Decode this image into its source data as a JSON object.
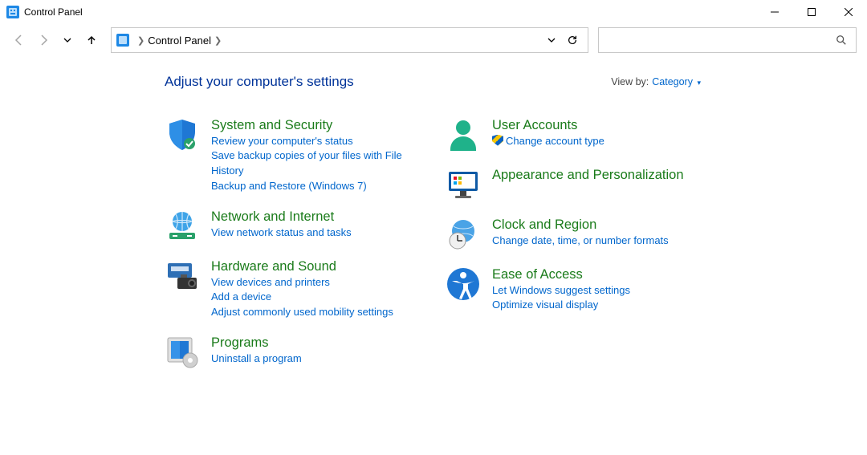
{
  "window": {
    "title": "Control Panel"
  },
  "breadcrumb": {
    "root": "Control Panel"
  },
  "viewby": {
    "label": "View by:",
    "value": "Category"
  },
  "page": {
    "title": "Adjust your computer's settings"
  },
  "left": [
    {
      "name": "System and Security",
      "subs": [
        {
          "label": "Review your computer's status"
        },
        {
          "label": "Save backup copies of your files with File History"
        },
        {
          "label": "Backup and Restore (Windows 7)"
        }
      ]
    },
    {
      "name": "Network and Internet",
      "subs": [
        {
          "label": "View network status and tasks"
        }
      ]
    },
    {
      "name": "Hardware and Sound",
      "subs": [
        {
          "label": "View devices and printers"
        },
        {
          "label": "Add a device"
        },
        {
          "label": "Adjust commonly used mobility settings"
        }
      ]
    },
    {
      "name": "Programs",
      "subs": [
        {
          "label": "Uninstall a program"
        }
      ]
    }
  ],
  "right": [
    {
      "name": "User Accounts",
      "subs": [
        {
          "label": "Change account type",
          "shield": true
        }
      ]
    },
    {
      "name": "Appearance and Personalization",
      "subs": []
    },
    {
      "name": "Clock and Region",
      "subs": [
        {
          "label": "Change date, time, or number formats"
        }
      ]
    },
    {
      "name": "Ease of Access",
      "subs": [
        {
          "label": "Let Windows suggest settings"
        },
        {
          "label": "Optimize visual display"
        }
      ]
    }
  ]
}
